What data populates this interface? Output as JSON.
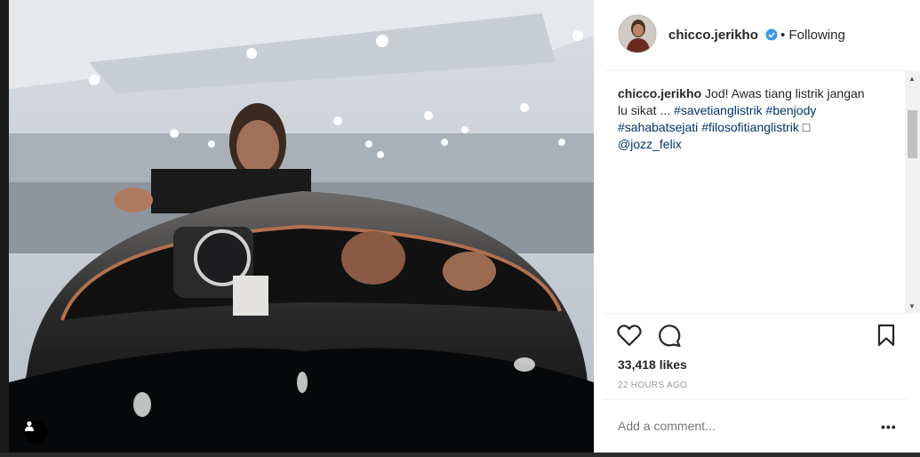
{
  "post": {
    "username": "chicco.jerikho",
    "separator": "•",
    "follow_status": "Following",
    "caption_user": "chicco.jerikho",
    "caption_line1": " Jod! Awas tiang listrik jangan",
    "caption_line2": "lu sikat ... ",
    "hashtags": [
      "#savetianglistrik",
      "#benjody",
      "#sahabatsejati",
      "#filosofitianglistrik"
    ],
    "caption_emoji": "□",
    "mention": "@jozz_felix",
    "likes": "33,418 likes",
    "time": "22 HOURS AGO",
    "comment_placeholder": "Add a comment...",
    "more_label": "•••"
  },
  "icons": {
    "like": "heart-icon",
    "comment": "comment-icon",
    "save": "bookmark-icon",
    "verified": "verified-badge-icon",
    "tagged_users": "person-tag-icon"
  },
  "colors": {
    "hashtag": "#003569",
    "verified": "#3897f0",
    "text": "#262626",
    "muted": "#999999"
  }
}
